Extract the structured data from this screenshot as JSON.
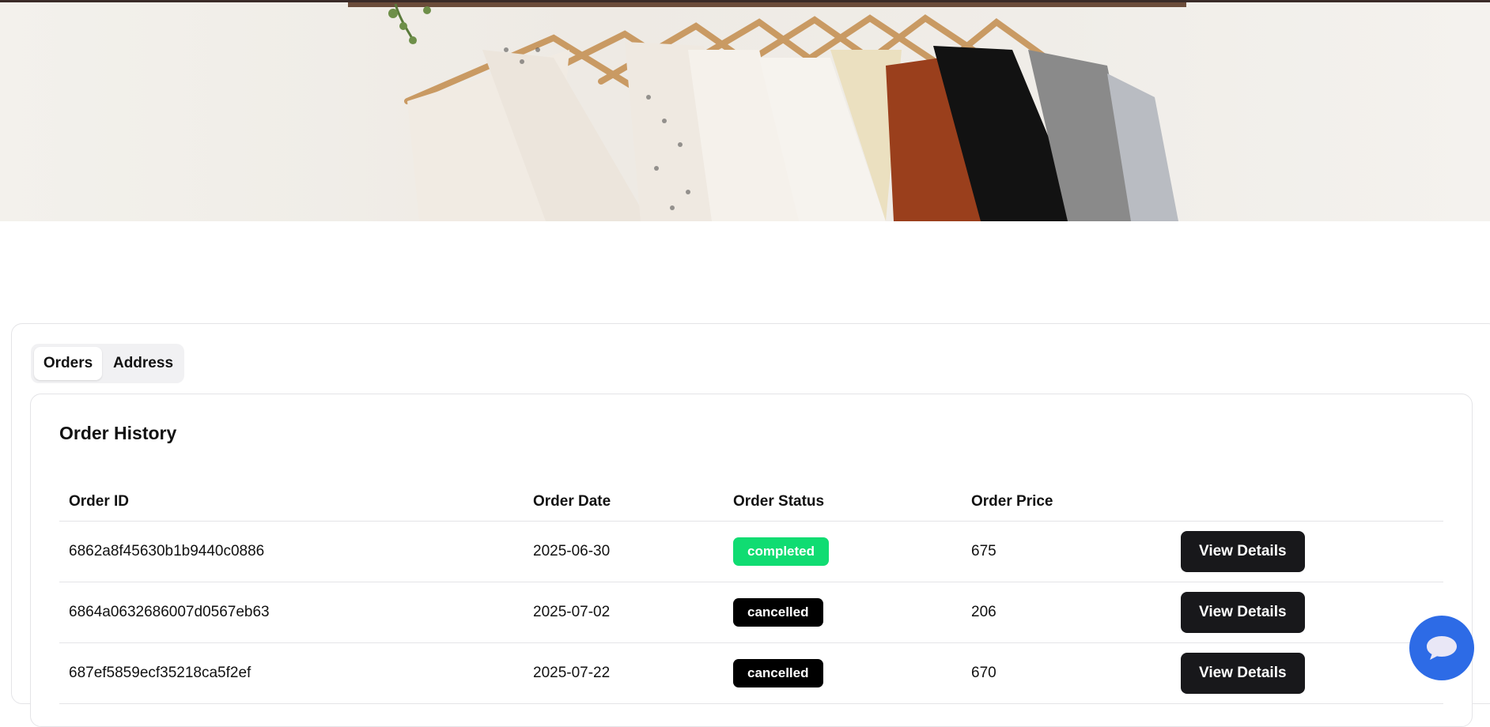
{
  "banner": {
    "alt": "clothes-on-hangers-banner"
  },
  "tabs": [
    {
      "label": "Orders",
      "active": true
    },
    {
      "label": "Address",
      "active": false
    }
  ],
  "order_history": {
    "title": "Order History",
    "columns": [
      "Order ID",
      "Order Date",
      "Order Status",
      "Order Price",
      ""
    ],
    "rows": [
      {
        "id": "6862a8f45630b1b9440c0886",
        "date": "2025-06-30",
        "status": "completed",
        "price": "675",
        "action": "View Details"
      },
      {
        "id": "6864a0632686007d0567eb63",
        "date": "2025-07-02",
        "status": "cancelled",
        "price": "206",
        "action": "View Details"
      },
      {
        "id": "687ef5859ecf35218ca5f2ef",
        "date": "2025-07-22",
        "status": "cancelled",
        "price": "670",
        "action": "View Details"
      }
    ]
  },
  "chat": {
    "icon": "chat-bubble-icon"
  },
  "colors": {
    "completed": "#10dc72",
    "cancelled": "#000000",
    "button": "#18181b",
    "chat": "#2d6be6"
  }
}
